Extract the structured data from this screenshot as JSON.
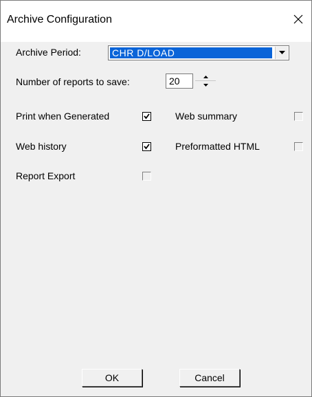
{
  "window": {
    "title": "Archive Configuration"
  },
  "archive_period": {
    "label": "Archive Period:",
    "value": "CHR D/LOAD"
  },
  "reports": {
    "label": "Number of reports to save:",
    "value": "20"
  },
  "options": [
    {
      "label": "Print when Generated",
      "checked": true
    },
    {
      "label": "Web summary",
      "checked": false
    },
    {
      "label": "Web history",
      "checked": true
    },
    {
      "label": "Preformatted HTML",
      "checked": false
    },
    {
      "label": "Report Export",
      "checked": false
    }
  ],
  "buttons": {
    "ok": "OK",
    "cancel": "Cancel"
  },
  "colors": {
    "selection": "#0a64d8",
    "dialog_bg": "#f0f0f0"
  }
}
